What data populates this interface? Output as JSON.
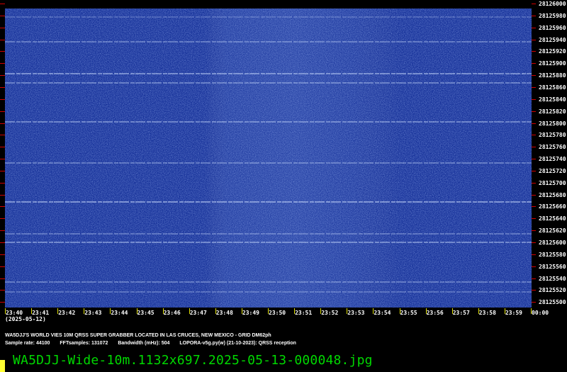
{
  "image": {
    "date_label": "(2025-05-12)",
    "info_line": "WA5DJJ'S WORLD VIES 10M QRSS SUPER GRABBER LOCATED IN LAS CRUCES, NEW MEXICO - GRID DM62ph",
    "params": [
      "Sample rate: 44100",
      "FFTsamples: 131072",
      "Bandwidth (mHz): 504",
      "LOPORA-v5g.py(w) (21-10-2023): QRSS reception"
    ],
    "filename": "WA5DJJ-Wide-10m.1132x697.2025-05-13-000048.jpg"
  },
  "frequency_labels": [
    "28126000",
    "28125980",
    "28125960",
    "28125940",
    "28125920",
    "28125900",
    "28125880",
    "28125860",
    "28125840",
    "28125820",
    "28125800",
    "28125780",
    "28125760",
    "28125740",
    "28125720",
    "28125700",
    "28125680",
    "28125660",
    "28125640",
    "28125620",
    "28125600",
    "28125580",
    "28125560",
    "28125540",
    "28125520",
    "28125500"
  ],
  "time_labels": [
    "23:40",
    "23:41",
    "23:42",
    "23:43",
    "23:44",
    "23:45",
    "23:46",
    "23:47",
    "23:48",
    "23:49",
    "23:50",
    "23:51",
    "23:52",
    "23:53",
    "23:54",
    "23:55",
    "23:56",
    "23:57",
    "23:58",
    "23:59",
    "00:00"
  ],
  "colors": {
    "background": "#000000",
    "spectrogram_base": "#17329a",
    "tick_red": "#d10000",
    "tick_yellow": "#d8d800",
    "filename_green": "#00d800",
    "corner_yellow": "#ffff33"
  }
}
